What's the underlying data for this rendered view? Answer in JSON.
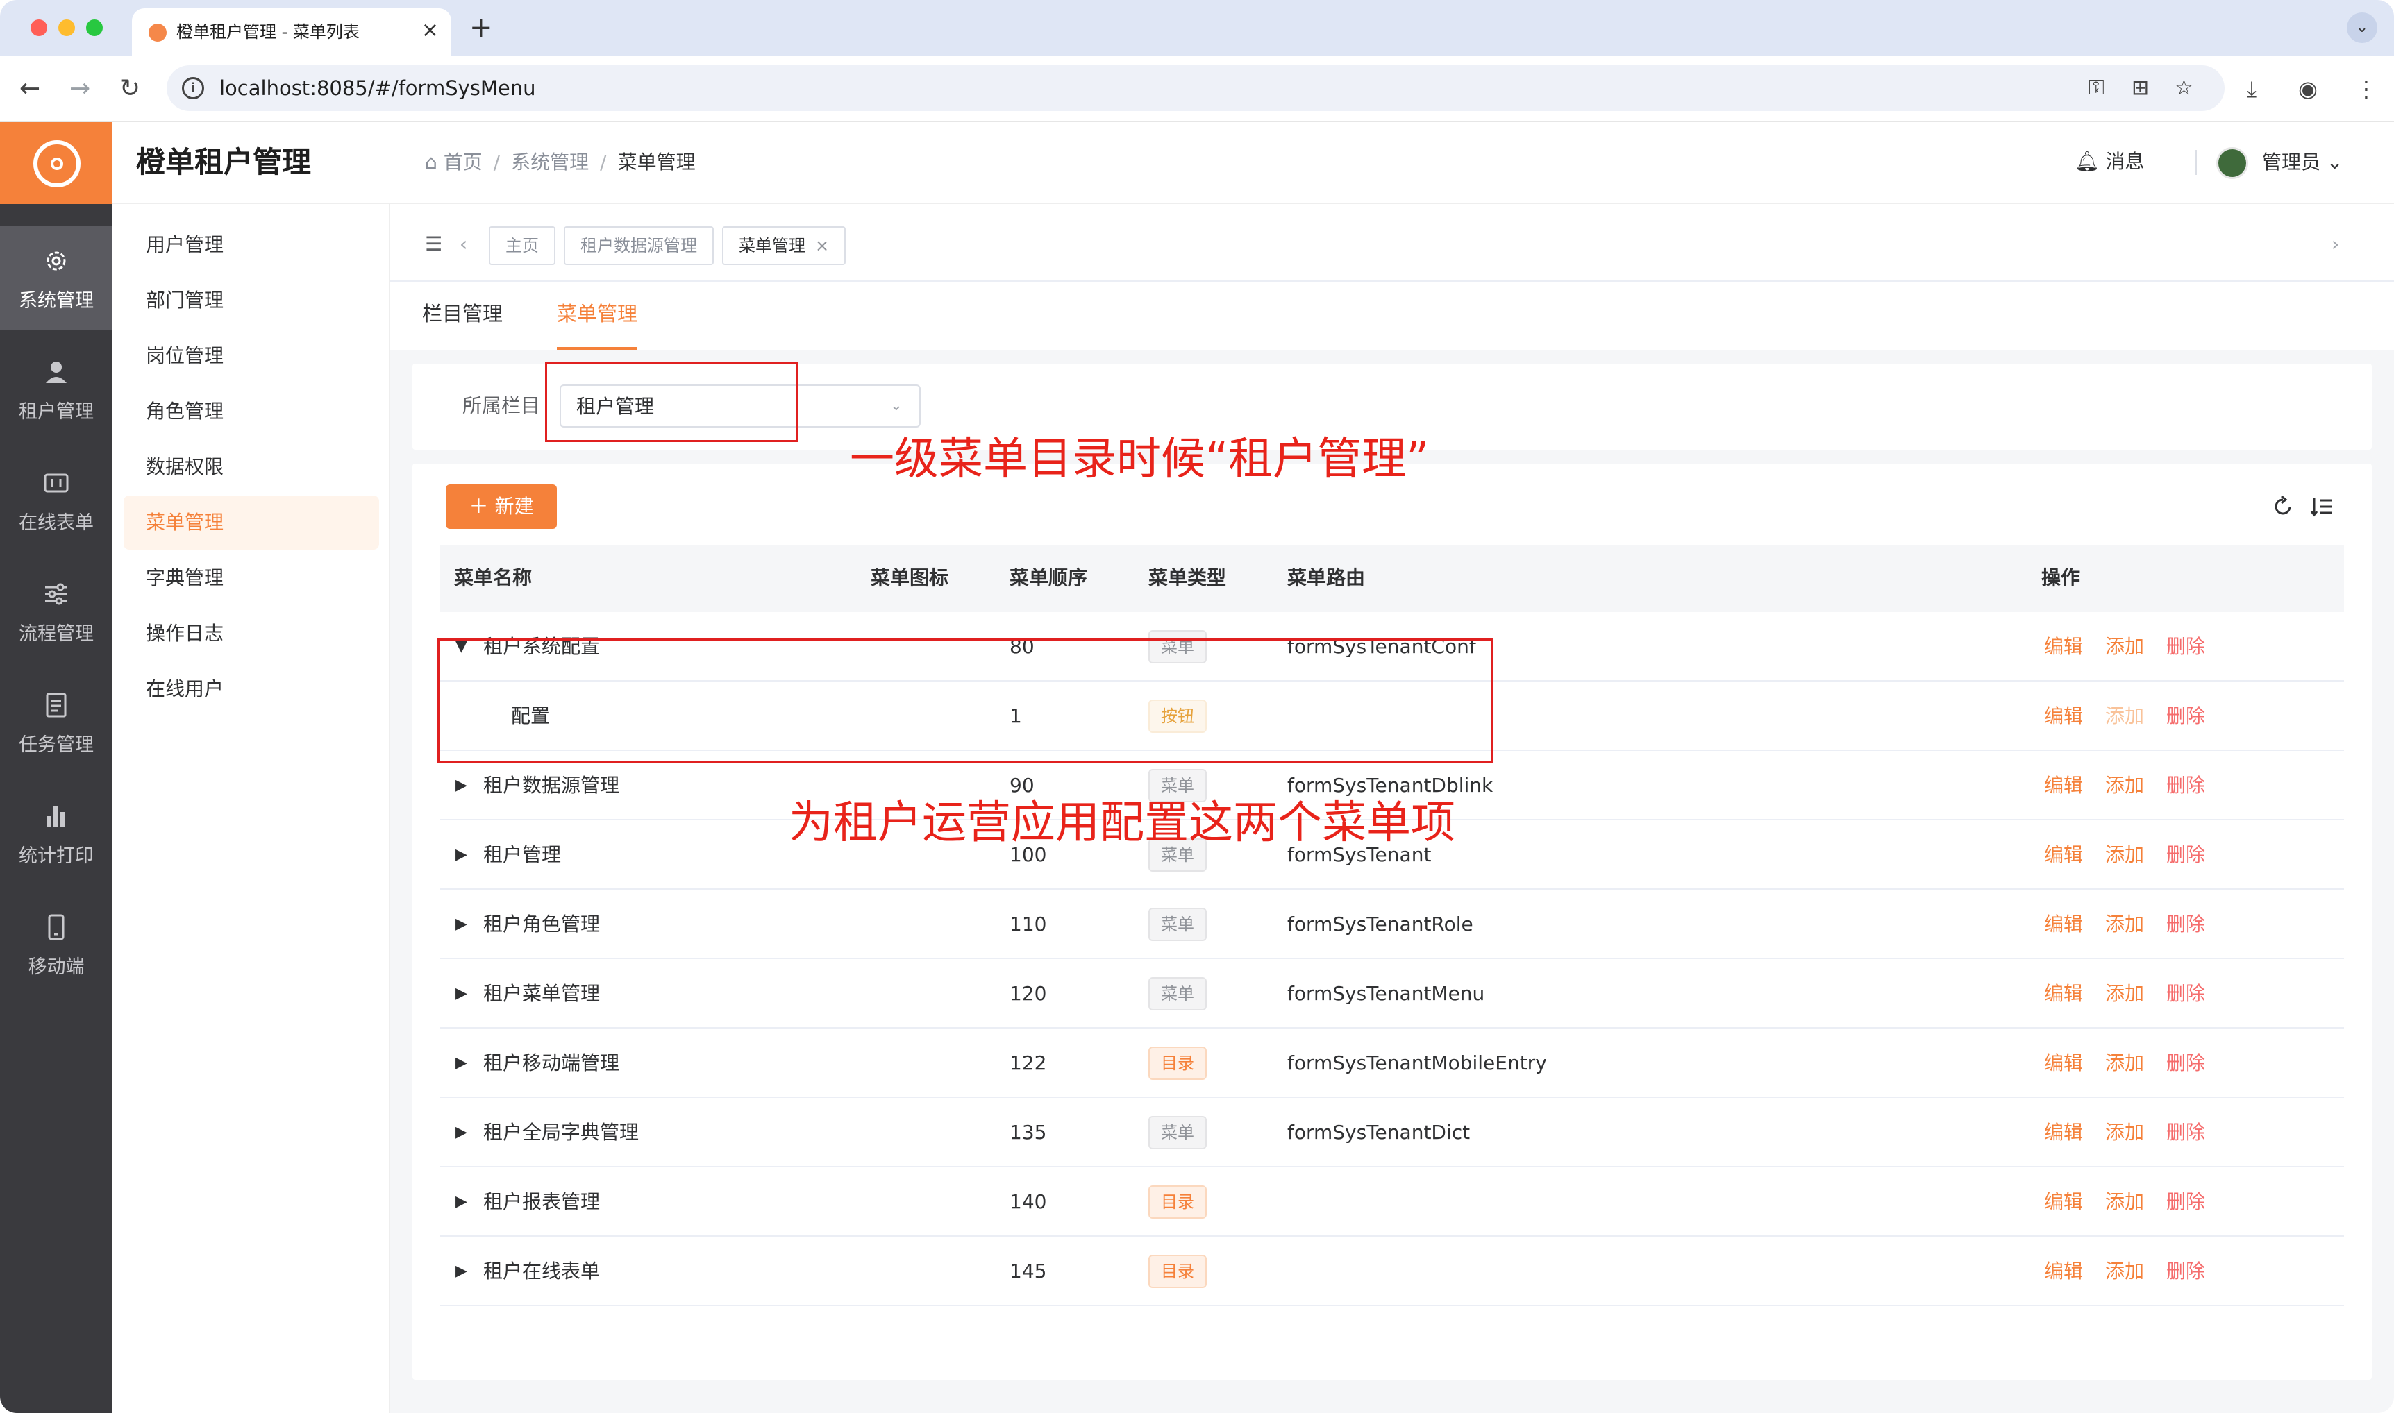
{
  "browser": {
    "tab_title": "橙单租户管理 - 菜单列表",
    "url": "localhost:8085/#/formSysMenu"
  },
  "app": {
    "title": "橙单租户管理",
    "brand_color": "#f5813a"
  },
  "rail": {
    "items": [
      {
        "label": "系统管理",
        "icon": "gear-icon",
        "active": true
      },
      {
        "label": "租户管理",
        "icon": "person-icon"
      },
      {
        "label": "在线表单",
        "icon": "form-icon"
      },
      {
        "label": "流程管理",
        "icon": "sliders-icon"
      },
      {
        "label": "任务管理",
        "icon": "document-icon"
      },
      {
        "label": "统计打印",
        "icon": "bar-chart-icon"
      },
      {
        "label": "移动端",
        "icon": "mobile-icon"
      }
    ]
  },
  "header": {
    "breadcrumb": {
      "home": "首页",
      "parent": "系统管理",
      "current": "菜单管理"
    },
    "message": "消息",
    "user": "管理员"
  },
  "sidemenu": {
    "items": [
      "用户管理",
      "部门管理",
      "岗位管理",
      "角色管理",
      "数据权限",
      "菜单管理",
      "字典管理",
      "操作日志",
      "在线用户"
    ],
    "active": "菜单管理"
  },
  "tags": [
    "主页",
    "租户数据源管理",
    "菜单管理"
  ],
  "subtabs": {
    "first": "栏目管理",
    "second": "菜单管理",
    "active": "菜单管理"
  },
  "filter": {
    "label": "所属栏目",
    "value": "租户管理"
  },
  "toolbar": {
    "new_label": "新建"
  },
  "table": {
    "columns": [
      "菜单名称",
      "菜单图标",
      "菜单顺序",
      "菜单类型",
      "菜单路由",
      "操作"
    ],
    "actions": {
      "edit": "编辑",
      "add": "添加",
      "delete": "删除"
    },
    "rows": [
      {
        "name": "租户系统配置",
        "order": "80",
        "type": "菜单",
        "type_kind": "menu",
        "route": "formSysTenantConf",
        "expanded": true
      },
      {
        "name": "配置",
        "order": "1",
        "type": "按钮",
        "type_kind": "btn",
        "route": "",
        "child": true,
        "add_disabled": true
      },
      {
        "name": "租户数据源管理",
        "order": "90",
        "type": "菜单",
        "type_kind": "menu",
        "route": "formSysTenantDblink"
      },
      {
        "name": "租户管理",
        "order": "100",
        "type": "菜单",
        "type_kind": "menu",
        "route": "formSysTenant"
      },
      {
        "name": "租户角色管理",
        "order": "110",
        "type": "菜单",
        "type_kind": "menu",
        "route": "formSysTenantRole"
      },
      {
        "name": "租户菜单管理",
        "order": "120",
        "type": "菜单",
        "type_kind": "menu",
        "route": "formSysTenantMenu"
      },
      {
        "name": "租户移动端管理",
        "order": "122",
        "type": "目录",
        "type_kind": "dir",
        "route": "formSysTenantMobileEntry"
      },
      {
        "name": "租户全局字典管理",
        "order": "135",
        "type": "菜单",
        "type_kind": "menu",
        "route": "formSysTenantDict"
      },
      {
        "name": "租户报表管理",
        "order": "140",
        "type": "目录",
        "type_kind": "dir",
        "route": ""
      },
      {
        "name": "租户在线表单",
        "order": "145",
        "type": "目录",
        "type_kind": "dir",
        "route": ""
      }
    ]
  },
  "annotations": {
    "top": "一级菜单目录时候“租户管理”",
    "middle": "为租户运营应用配置这两个菜单项"
  }
}
